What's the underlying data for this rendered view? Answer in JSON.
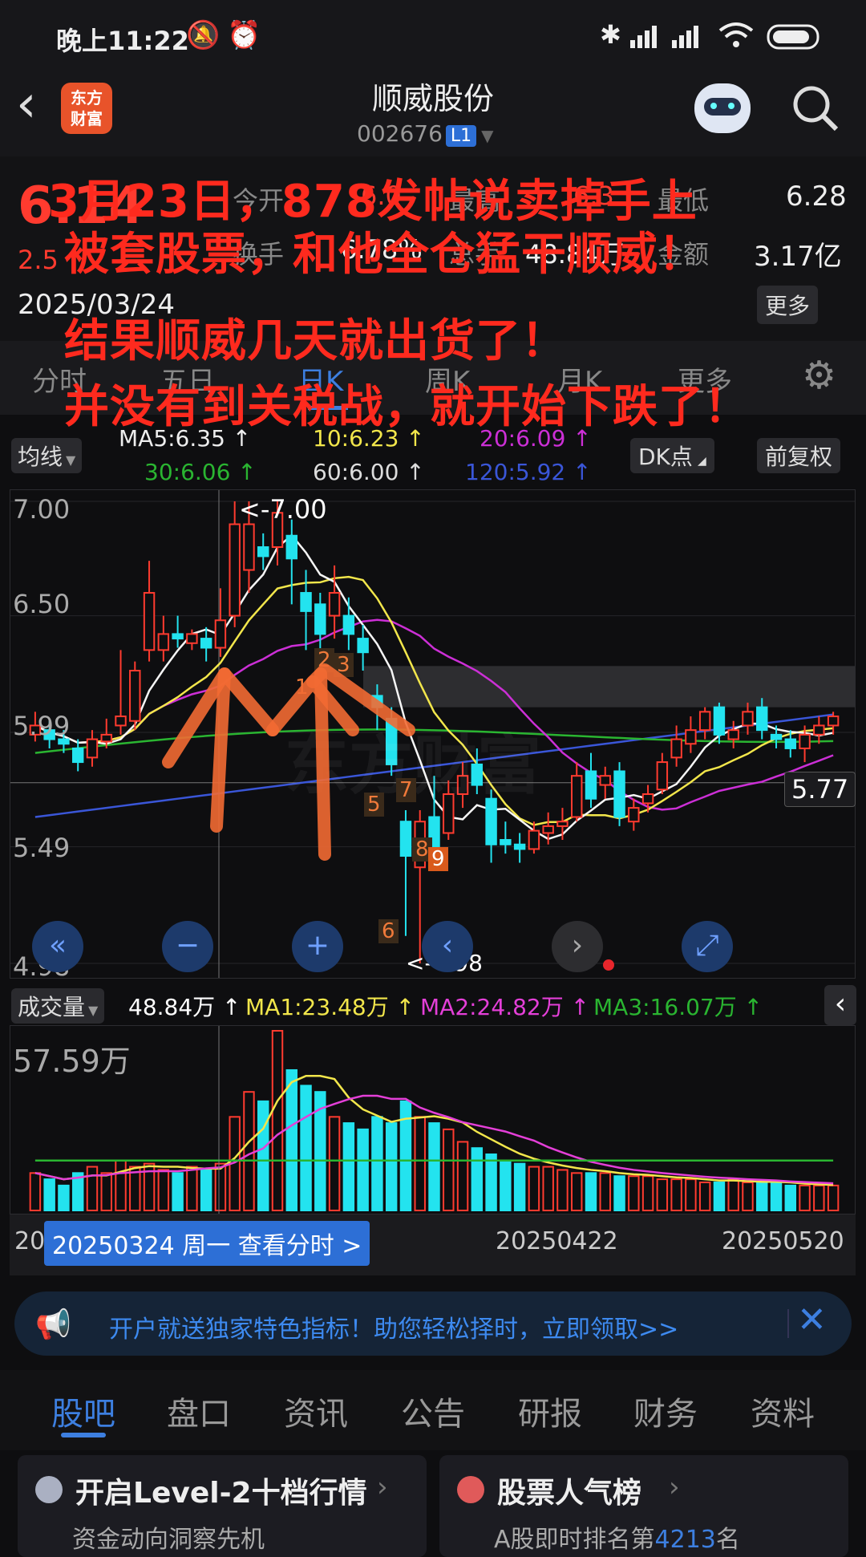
{
  "status": {
    "time": "晚上11:22",
    "battery_level": 0.9
  },
  "header": {
    "app_logo_line1": "东方",
    "app_logo_line2": "财富",
    "title": "顺威股份",
    "code": "002676",
    "level": "L1"
  },
  "quote": {
    "price": "6.14",
    "change": "2.5",
    "date": "2025/03/24",
    "open_label": "今开",
    "open_value": "6.0",
    "high_label": "最高",
    "high_value": "6.3",
    "low_label": "最低",
    "low_value": "6.28",
    "turnover_label": "换手",
    "turnover_value": "6.78%",
    "vol_label": "总手",
    "vol_value": "48.84万",
    "amount_label": "金额",
    "amount_value": "3.17亿",
    "more_button": "更多"
  },
  "overlay_text": [
    "3月23日，878发帖说卖掉手上",
    "被套股票，和他全仓猛干顺威！",
    "结果顺威几天就出货了！",
    "并没有到关税战，就开始下跌了！"
  ],
  "tabs": [
    "分时",
    "五日",
    "日K",
    "周K",
    "月K",
    "更多"
  ],
  "ma": {
    "selector": "均线",
    "ma5": "MA5:6.35 ↑",
    "ma10": "10:6.23 ↑",
    "ma20": "20:6.09 ↑",
    "ma30": "30:6.06 ↑",
    "ma60": "60:6.00 ↑",
    "ma120": "120:5.92 ↑",
    "dk_button": "DK点",
    "adjust_button": "前复权"
  },
  "chart": {
    "y_labels": [
      "7.00",
      "6.50",
      "5.99",
      "5.49",
      "4.98"
    ],
    "high_marker": "<-7.00",
    "low_marker": "<-4.98",
    "price_tag": "5.77",
    "signals": [
      "1",
      "2",
      "3",
      "5",
      "6",
      "7",
      "8",
      "9"
    ],
    "watermark": "东方财富"
  },
  "volume": {
    "selector": "成交量",
    "value": "48.84万 ↑",
    "ma1": "MA1:23.48万 ↑",
    "ma2": "MA2:24.82万 ↑",
    "ma3": "MA3:16.07万 ↑",
    "max_label": "57.59万"
  },
  "x_axis": {
    "start": "20",
    "hover": "20250324 周一 查看分时 >",
    "mid": "20250422",
    "end": "20250520"
  },
  "banner": {
    "text": "开户就送独家特色指标！助您轻松择时，立即领取>>"
  },
  "bottom_tabs": [
    "股吧",
    "盘口",
    "资讯",
    "公告",
    "研报",
    "财务",
    "资料"
  ],
  "cards": {
    "left_title": "开启Level-2十档行情",
    "left_sub": "资金动向洞察先机",
    "right_title": "股票人气榜",
    "right_sub_prefix": "A股即时排名第",
    "right_rank": "4213",
    "right_sub_suffix": "名"
  },
  "colors": {
    "up": "#ff3b2f",
    "down": "#23e3ef",
    "accent": "#3d7fe0",
    "overlay": "#ff2a1e"
  },
  "chart_data": {
    "type": "candlestick",
    "ylim": [
      4.98,
      7.0
    ],
    "candles": [
      {
        "o": 5.98,
        "c": 6.02,
        "h": 6.08,
        "l": 5.95
      },
      {
        "o": 6.0,
        "c": 5.96,
        "h": 6.04,
        "l": 5.92
      },
      {
        "o": 5.96,
        "c": 5.94,
        "h": 6.0,
        "l": 5.9
      },
      {
        "o": 5.92,
        "c": 5.86,
        "h": 5.96,
        "l": 5.82
      },
      {
        "o": 5.88,
        "c": 5.96,
        "h": 6.0,
        "l": 5.84
      },
      {
        "o": 5.95,
        "c": 5.98,
        "h": 6.05,
        "l": 5.92
      },
      {
        "o": 6.02,
        "c": 6.06,
        "h": 6.35,
        "l": 5.98
      },
      {
        "o": 6.04,
        "c": 6.26,
        "h": 6.3,
        "l": 6.0
      },
      {
        "o": 6.35,
        "c": 6.6,
        "h": 6.74,
        "l": 6.3
      },
      {
        "o": 6.35,
        "c": 6.42,
        "h": 6.5,
        "l": 6.3
      },
      {
        "o": 6.42,
        "c": 6.4,
        "h": 6.5,
        "l": 6.36
      },
      {
        "o": 6.38,
        "c": 6.42,
        "h": 6.44,
        "l": 6.35
      },
      {
        "o": 6.4,
        "c": 6.36,
        "h": 6.45,
        "l": 6.3
      },
      {
        "o": 6.36,
        "c": 6.48,
        "h": 6.62,
        "l": 6.32
      },
      {
        "o": 6.5,
        "c": 6.9,
        "h": 7.0,
        "l": 6.45
      },
      {
        "o": 6.7,
        "c": 6.9,
        "h": 7.0,
        "l": 6.6
      },
      {
        "o": 6.8,
        "c": 6.76,
        "h": 6.86,
        "l": 6.7
      },
      {
        "o": 6.8,
        "c": 6.95,
        "h": 7.0,
        "l": 6.72
      },
      {
        "o": 6.85,
        "c": 6.75,
        "h": 6.92,
        "l": 6.55
      },
      {
        "o": 6.6,
        "c": 6.52,
        "h": 6.7,
        "l": 6.35
      },
      {
        "o": 6.55,
        "c": 6.42,
        "h": 6.6,
        "l": 6.35
      },
      {
        "o": 6.5,
        "c": 6.6,
        "h": 6.72,
        "l": 6.4
      },
      {
        "o": 6.5,
        "c": 6.42,
        "h": 6.58,
        "l": 6.35
      },
      {
        "o": 6.4,
        "c": 6.34,
        "h": 6.46,
        "l": 6.26
      },
      {
        "o": 6.15,
        "c": 6.1,
        "h": 6.2,
        "l": 6.0
      },
      {
        "o": 6.05,
        "c": 5.85,
        "h": 6.1,
        "l": 5.8
      },
      {
        "o": 5.6,
        "c": 5.45,
        "h": 5.65,
        "l": 5.1
      },
      {
        "o": 5.4,
        "c": 5.6,
        "h": 5.65,
        "l": 4.98
      },
      {
        "o": 5.62,
        "c": 5.48,
        "h": 5.8,
        "l": 5.4
      },
      {
        "o": 5.55,
        "c": 5.72,
        "h": 5.78,
        "l": 5.52
      },
      {
        "o": 5.72,
        "c": 5.8,
        "h": 5.86,
        "l": 5.66
      },
      {
        "o": 5.85,
        "c": 5.76,
        "h": 5.92,
        "l": 5.72
      },
      {
        "o": 5.7,
        "c": 5.5,
        "h": 5.74,
        "l": 5.42
      },
      {
        "o": 5.52,
        "c": 5.5,
        "h": 5.6,
        "l": 5.46
      },
      {
        "o": 5.5,
        "c": 5.48,
        "h": 5.55,
        "l": 5.42
      },
      {
        "o": 5.48,
        "c": 5.56,
        "h": 5.6,
        "l": 5.46
      },
      {
        "o": 5.55,
        "c": 5.58,
        "h": 5.64,
        "l": 5.5
      },
      {
        "o": 5.58,
        "c": 5.6,
        "h": 5.66,
        "l": 5.52
      },
      {
        "o": 5.62,
        "c": 5.8,
        "h": 5.86,
        "l": 5.6
      },
      {
        "o": 5.82,
        "c": 5.7,
        "h": 5.9,
        "l": 5.66
      },
      {
        "o": 5.76,
        "c": 5.8,
        "h": 5.84,
        "l": 5.7
      },
      {
        "o": 5.82,
        "c": 5.62,
        "h": 5.86,
        "l": 5.58
      },
      {
        "o": 5.6,
        "c": 5.66,
        "h": 5.7,
        "l": 5.56
      },
      {
        "o": 5.68,
        "c": 5.72,
        "h": 5.76,
        "l": 5.64
      },
      {
        "o": 5.74,
        "c": 5.86,
        "h": 5.9,
        "l": 5.72
      },
      {
        "o": 5.88,
        "c": 5.96,
        "h": 6.02,
        "l": 5.84
      },
      {
        "o": 5.94,
        "c": 6.0,
        "h": 6.06,
        "l": 5.9
      },
      {
        "o": 6.0,
        "c": 6.08,
        "h": 6.1,
        "l": 5.96
      },
      {
        "o": 6.1,
        "c": 5.98,
        "h": 6.12,
        "l": 5.94
      },
      {
        "o": 5.96,
        "c": 6.0,
        "h": 6.04,
        "l": 5.92
      },
      {
        "o": 6.02,
        "c": 6.08,
        "h": 6.12,
        "l": 5.98
      },
      {
        "o": 6.1,
        "c": 6.0,
        "h": 6.14,
        "l": 5.96
      },
      {
        "o": 5.98,
        "c": 5.96,
        "h": 6.02,
        "l": 5.92
      },
      {
        "o": 5.96,
        "c": 5.92,
        "h": 6.0,
        "l": 5.88
      },
      {
        "o": 5.92,
        "c": 5.98,
        "h": 6.02,
        "l": 5.86
      },
      {
        "o": 5.98,
        "c": 6.02,
        "h": 6.06,
        "l": 5.94
      },
      {
        "o": 6.02,
        "c": 6.06,
        "h": 6.08,
        "l": 5.98
      }
    ],
    "volumes": [
      12,
      10,
      8,
      12,
      14,
      12,
      16,
      14,
      15,
      13,
      12,
      14,
      13,
      15,
      30,
      38,
      35,
      57.59,
      45,
      40,
      38,
      30,
      28,
      26,
      30,
      28,
      35,
      30,
      28,
      26,
      22,
      20,
      18,
      16,
      15,
      14,
      14,
      13,
      12,
      12,
      12,
      11,
      11,
      11,
      10,
      10,
      10,
      9,
      9,
      10,
      9,
      9,
      9,
      8,
      8,
      8,
      8
    ]
  }
}
